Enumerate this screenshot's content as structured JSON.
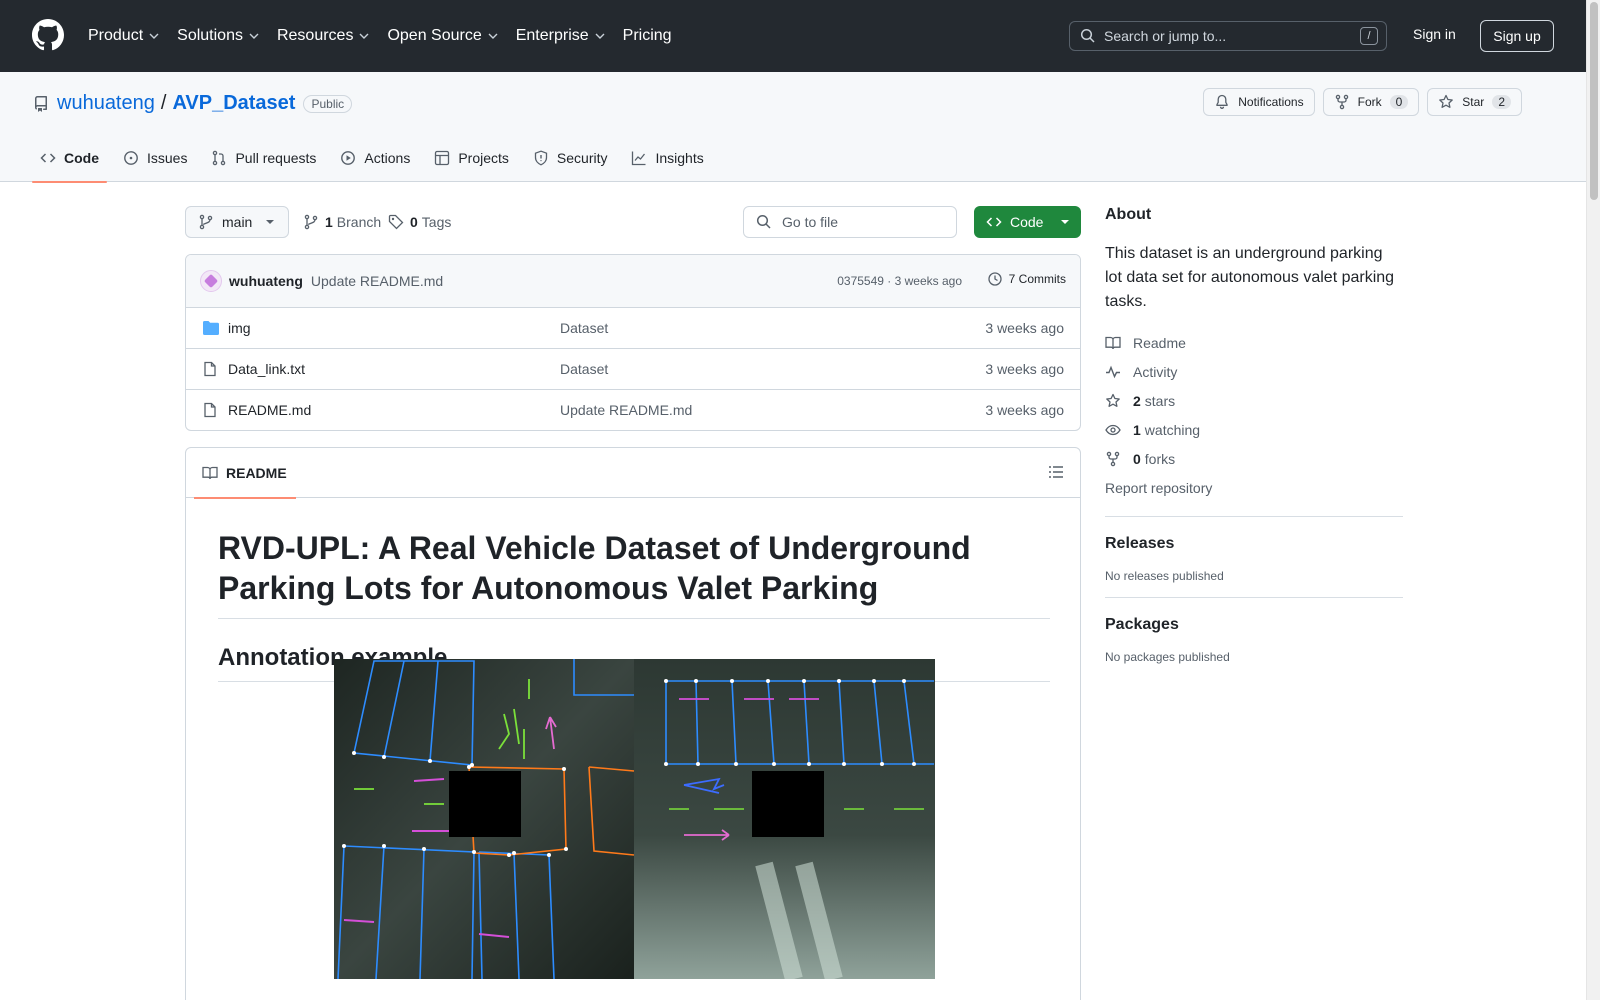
{
  "header": {
    "nav": [
      "Product",
      "Solutions",
      "Resources",
      "Open Source",
      "Enterprise",
      "Pricing"
    ],
    "search_placeholder": "Search or jump to...",
    "search_shortcut": "/",
    "signin": "Sign in",
    "signup": "Sign up"
  },
  "repo": {
    "owner": "wuhuateng",
    "separator": "/",
    "name": "AVP_Dataset",
    "visibility": "Public",
    "notifications": "Notifications",
    "fork_label": "Fork",
    "fork_count": "0",
    "star_label": "Star",
    "star_count": "2",
    "tabs": [
      "Code",
      "Issues",
      "Pull requests",
      "Actions",
      "Projects",
      "Security",
      "Insights"
    ]
  },
  "toolbar": {
    "branch": "main",
    "branch_count": "1",
    "branch_label": "Branch",
    "tag_count": "0",
    "tag_label": "Tags",
    "go_to_file": "Go to file",
    "code_button": "Code"
  },
  "commit": {
    "author": "wuhuateng",
    "message": "Update README.md",
    "meta": "0375549 · 3 weeks ago",
    "commits": "7 Commits"
  },
  "files": [
    {
      "name": "img",
      "message": "Dataset",
      "date": "3 weeks ago",
      "type": "folder"
    },
    {
      "name": "Data_link.txt",
      "message": "Dataset",
      "date": "3 weeks ago",
      "type": "file"
    },
    {
      "name": "README.md",
      "message": "Update README.md",
      "date": "3 weeks ago",
      "type": "file"
    }
  ],
  "readme": {
    "tab": "README",
    "title": "RVD-UPL: A Real Vehicle Dataset of Underground Parking Lots for Autonomous Valet Parking",
    "h2": "Annotation example"
  },
  "sidebar": {
    "about_title": "About",
    "about_desc": "This dataset is an underground parking lot data set for autonomous valet parking tasks.",
    "readme": "Readme",
    "activity": "Activity",
    "stars_count": "2",
    "stars_label": "stars",
    "watching_count": "1",
    "watching_label": "watching",
    "forks_count": "0",
    "forks_label": "forks",
    "report": "Report repository",
    "releases_title": "Releases",
    "releases_note": "No releases published",
    "packages_title": "Packages",
    "packages_note": "No packages published"
  },
  "colors": {
    "header_bg": "#24292f",
    "link": "#0969da",
    "primary_button": "#1f883d",
    "tab_underline": "#fd8c73"
  }
}
